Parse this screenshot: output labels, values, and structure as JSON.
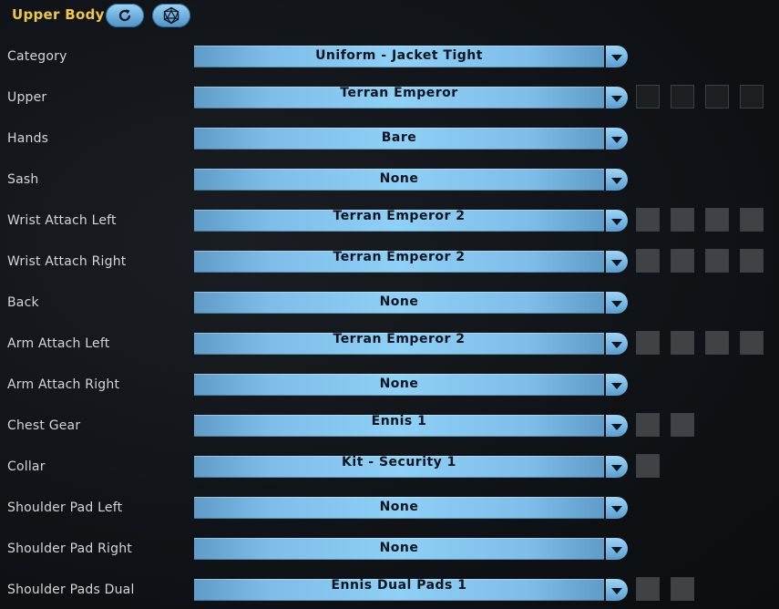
{
  "header": {
    "title": "Upper Body",
    "refresh_icon": "refresh-icon",
    "dice_icon": "dice-icon",
    "accent_color": "#f0c846"
  },
  "rows": [
    {
      "label": "Category",
      "value": "Uniform - Jacket Tight",
      "swatches": []
    },
    {
      "label": "Upper",
      "value": "Terran Emperor",
      "swatches": [
        "#1c1f22",
        "#1c1f22",
        "#1c1f22",
        "#1c1f22"
      ]
    },
    {
      "label": "Hands",
      "value": "Bare",
      "swatches": []
    },
    {
      "label": "Sash",
      "value": "None",
      "swatches": []
    },
    {
      "label": "Wrist Attach Left",
      "value": "Terran Emperor 2",
      "swatches": [
        "#404346",
        "#404346",
        "#404346",
        "#404346"
      ]
    },
    {
      "label": "Wrist Attach Right",
      "value": "Terran Emperor 2",
      "swatches": [
        "#404346",
        "#404346",
        "#404346",
        "#404346"
      ]
    },
    {
      "label": "Back",
      "value": "None",
      "swatches": []
    },
    {
      "label": "Arm Attach Left",
      "value": "Terran Emperor 2",
      "swatches": [
        "#404346",
        "#404346",
        "#404346",
        "#404346"
      ]
    },
    {
      "label": "Arm Attach Right",
      "value": "None",
      "swatches": []
    },
    {
      "label": "Chest Gear",
      "value": "Ennis 1",
      "swatches": [
        "#404346",
        "#404346"
      ]
    },
    {
      "label": "Collar",
      "value": "Kit - Security 1",
      "swatches": [
        "#404346"
      ]
    },
    {
      "label": "Shoulder Pad Left",
      "value": "None",
      "swatches": []
    },
    {
      "label": "Shoulder Pad Right",
      "value": "None",
      "swatches": []
    },
    {
      "label": "Shoulder Pads Dual",
      "value": "Ennis Dual Pads 1",
      "swatches": [
        "#404346",
        "#404346"
      ]
    }
  ]
}
